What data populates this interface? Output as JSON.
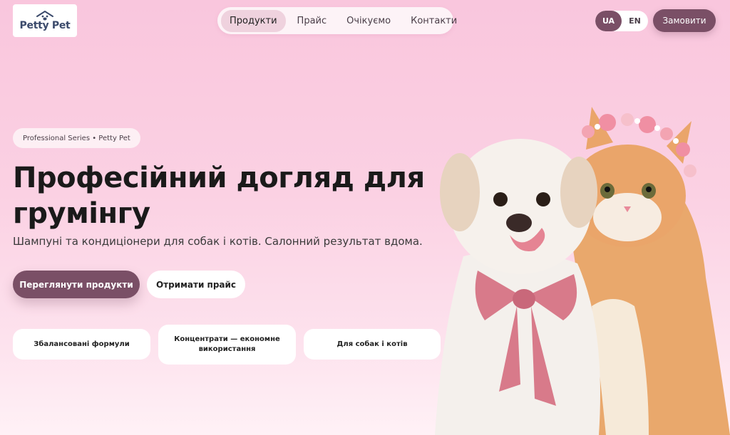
{
  "header": {
    "logo_text": "Petty Pet",
    "nav": [
      {
        "label": "Продукти",
        "active": true
      },
      {
        "label": "Прайс",
        "active": false
      },
      {
        "label": "Очікуємо",
        "active": false
      },
      {
        "label": "Контакти",
        "active": false
      }
    ],
    "languages": [
      {
        "label": "UA",
        "active": true
      },
      {
        "label": "EN",
        "active": false
      }
    ],
    "order_label": "Замовити"
  },
  "hero": {
    "badge": "Professional Series • Petty Pet",
    "title": "Професійний догляд для грумінгу",
    "subtitle": "Шампуні та кондиціонери для собак і котів. Салонний результат вдома.",
    "primary_cta": "Переглянути продукти",
    "secondary_cta": "Отримати прайс",
    "features": [
      "Збалансовані формули",
      "Концентрати — економне використання",
      "Для собак і котів"
    ]
  },
  "colors": {
    "accent": "#7a4f66",
    "background": "#fbd1e3",
    "logo_text": "#3b4a6b"
  },
  "images": {
    "hero": "dog-and-cat-with-flower-crown-and-bow"
  }
}
